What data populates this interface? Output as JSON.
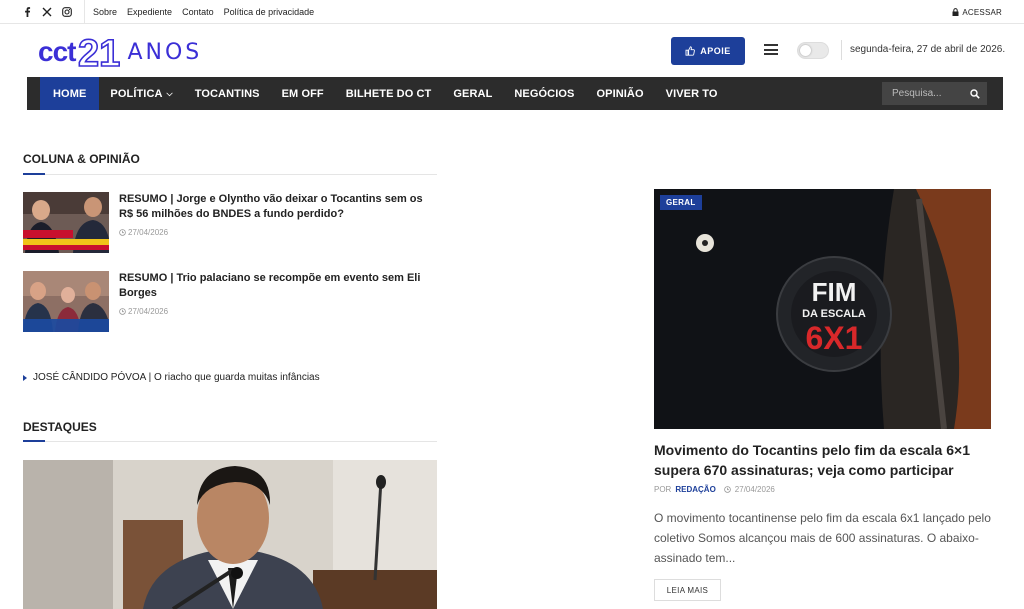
{
  "topbar": {
    "links": [
      "Sobre",
      "Expediente",
      "Contato",
      "Política de privacidade"
    ],
    "login_label": "ACESSAR"
  },
  "header": {
    "logo_prefix": "cct",
    "logo_number": "21",
    "logo_suffix": "ANOS",
    "apoie_label": "APOIE",
    "date": "segunda-feira, 27 de abril de 2026."
  },
  "nav": {
    "items": [
      "HOME",
      "POLÍTICA",
      "TOCANTINS",
      "EM OFF",
      "BILHETE DO CT",
      "GERAL",
      "NEGÓCIOS",
      "OPINIÃO",
      "VIVER TO"
    ],
    "search_placeholder": "Pesquisa..."
  },
  "opinion": {
    "title": "COLUNA & OPINIÃO",
    "items": [
      {
        "title": "RESUMO | Jorge e Olyntho vão deixar o Tocantins sem os R$ 56 milhões do BNDES a fundo perdido?",
        "date": "27/04/2026"
      },
      {
        "title": "RESUMO | Trio palaciano se recompõe em evento sem Eli Borges",
        "date": "27/04/2026"
      }
    ],
    "more": "JOSÉ CÂNDIDO PÓVOA | O riacho que guarda muitas infâncias"
  },
  "highlights": {
    "title": "DESTAQUES"
  },
  "article": {
    "category": "GERAL",
    "title": "Movimento do Tocantins pelo fim da escala 6×1 supera 670 assinaturas; veja como participar",
    "by": "POR",
    "author": "REDAÇÃO",
    "date": "27/04/2026",
    "excerpt": "O movimento tocantinense pelo fim da escala 6x1 lançado pelo coletivo Somos alcançou mais de 600 assinaturas. O abaixo-assinado tem...",
    "read_more": "LEIA MAIS"
  },
  "colors": {
    "accent": "#1d3f9a",
    "logo": "#3b2fd6",
    "nav_bg": "#2c2c2c"
  }
}
